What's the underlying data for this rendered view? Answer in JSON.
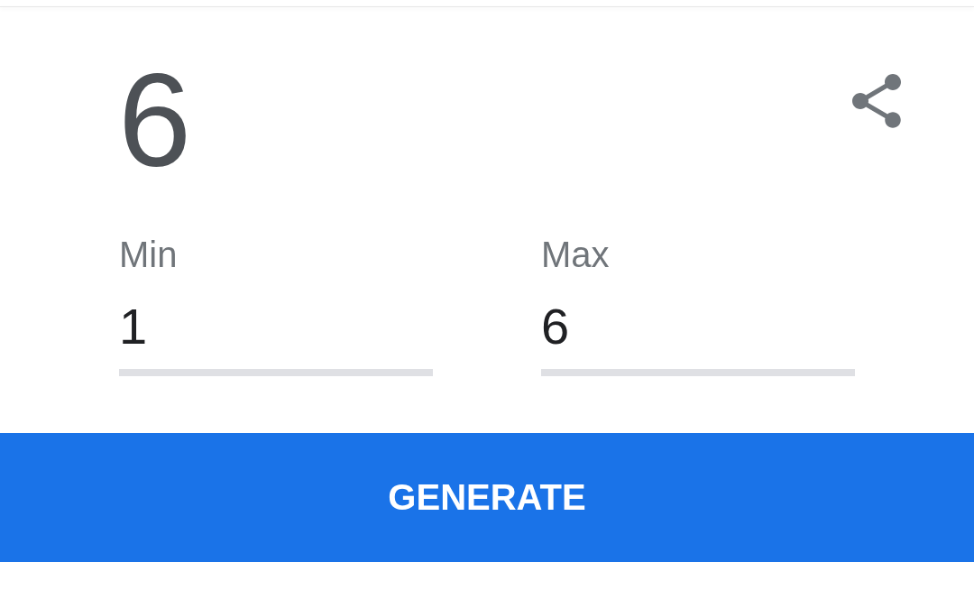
{
  "result": "6",
  "fields": [
    {
      "label": "Min",
      "value": "1"
    },
    {
      "label": "Max",
      "value": "6"
    }
  ],
  "button": {
    "label": "GENERATE"
  }
}
